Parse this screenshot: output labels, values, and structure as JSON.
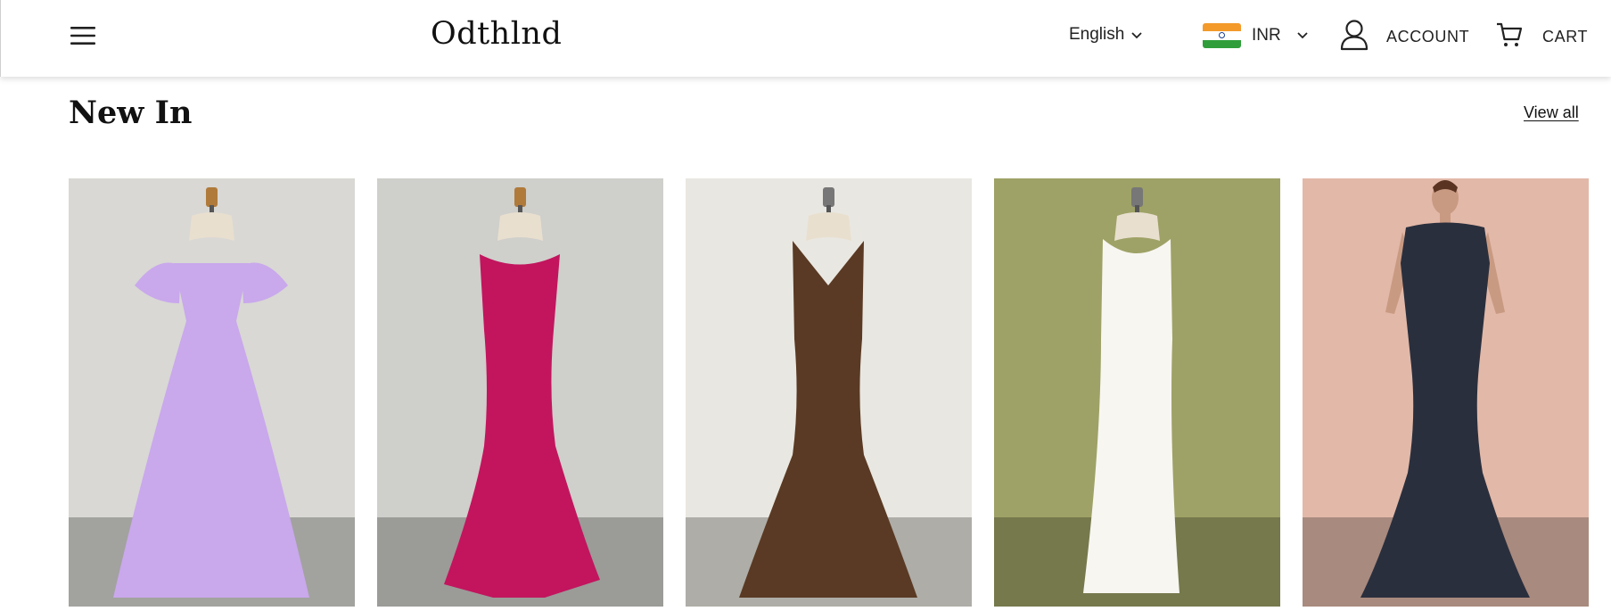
{
  "header": {
    "logo": "Odthlnd",
    "language": "English",
    "currency": "INR",
    "account_label": "ACCOUNT",
    "cart_label": "CART"
  },
  "section": {
    "title": "New In",
    "view_all": "View all"
  },
  "products": [
    {
      "icon": "dress-image",
      "color": "#c9a8ec",
      "background": "#d9d8d4"
    },
    {
      "icon": "dress-image",
      "color": "#c2155e",
      "background": "#cfcfcb"
    },
    {
      "icon": "dress-image",
      "color": "#5a3a24",
      "background": "#e9e7e1"
    },
    {
      "icon": "dress-image",
      "color": "#f7f6f1",
      "background": "#9ea266"
    },
    {
      "icon": "dress-image",
      "color": "#2a2f3d",
      "background": "#e2b8a8"
    }
  ]
}
